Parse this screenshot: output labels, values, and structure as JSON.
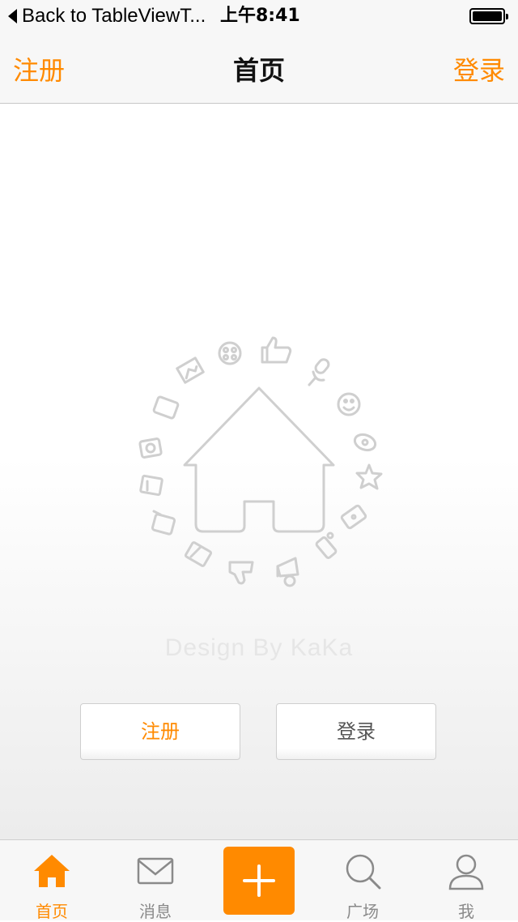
{
  "status_bar": {
    "back_label": "Back to TableViewT...",
    "time": "上午8:41"
  },
  "nav": {
    "left_label": "注册",
    "title": "首页",
    "right_label": "登录"
  },
  "main": {
    "design_text": "Design By KaKa",
    "register_button": "注册",
    "login_button": "登录"
  },
  "tabs": [
    {
      "label": "首页",
      "icon": "home-icon",
      "active": true
    },
    {
      "label": "消息",
      "icon": "mail-icon",
      "active": false
    },
    {
      "label": "",
      "icon": "plus-icon",
      "active": false
    },
    {
      "label": "广场",
      "icon": "search-icon",
      "active": false
    },
    {
      "label": "我",
      "icon": "user-icon",
      "active": false
    }
  ],
  "colors": {
    "accent": "#ff8a00",
    "bar_background": "#f7f7f7",
    "icon_gray": "#cfcfcf",
    "tab_gray": "#8a8a8a"
  }
}
